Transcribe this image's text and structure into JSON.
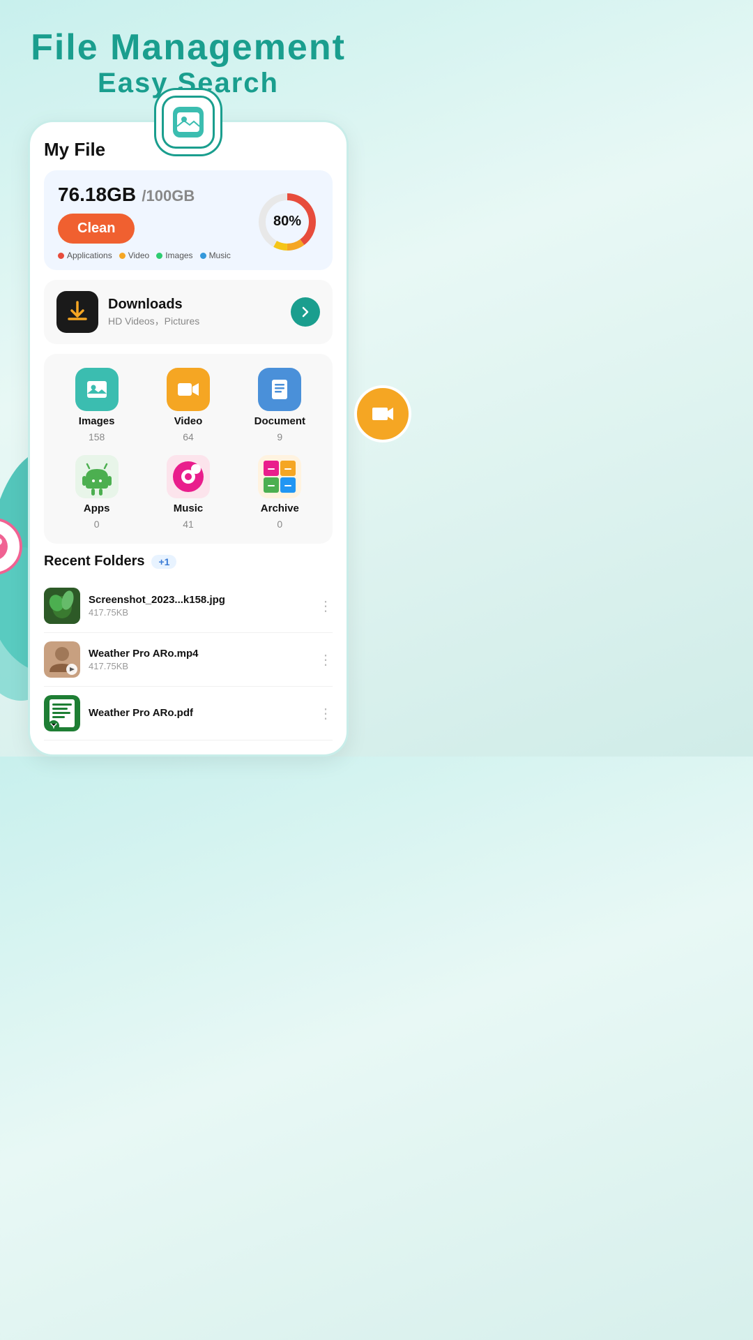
{
  "header": {
    "title_line1": "File  Management",
    "title_line2": "Easy  Search"
  },
  "storage": {
    "used": "76.18GB",
    "total": "/100GB",
    "percent": "80%",
    "percent_num": 80,
    "clean_label": "Clean",
    "legend": [
      {
        "color": "#e74c3c",
        "label": "Applications"
      },
      {
        "color": "#f5a623",
        "label": "Video"
      },
      {
        "color": "#2ecc71",
        "label": "Images"
      },
      {
        "color": "#3498db",
        "label": "Music"
      }
    ]
  },
  "downloads": {
    "name": "Downloads",
    "sub": "HD Videos，Pictures"
  },
  "grid_items": [
    {
      "name": "Images",
      "count": "158",
      "icon": "image"
    },
    {
      "name": "Video",
      "count": "64",
      "icon": "video"
    },
    {
      "name": "Document",
      "count": "9",
      "icon": "document"
    },
    {
      "name": "Apps",
      "count": "0",
      "icon": "apps"
    },
    {
      "name": "Music",
      "count": "41",
      "icon": "music"
    },
    {
      "name": "Archive",
      "count": "0",
      "icon": "archive"
    }
  ],
  "recent": {
    "title": "Recent Folders",
    "badge": "+1"
  },
  "files": [
    {
      "name": "Screenshot_2023...k158.jpg",
      "size": "417.75KB",
      "type": "image"
    },
    {
      "name": "Weather Pro ARo.mp4",
      "size": "417.75KB",
      "type": "video"
    },
    {
      "name": "Weather Pro ARo.pdf",
      "size": "",
      "type": "pdf"
    }
  ]
}
